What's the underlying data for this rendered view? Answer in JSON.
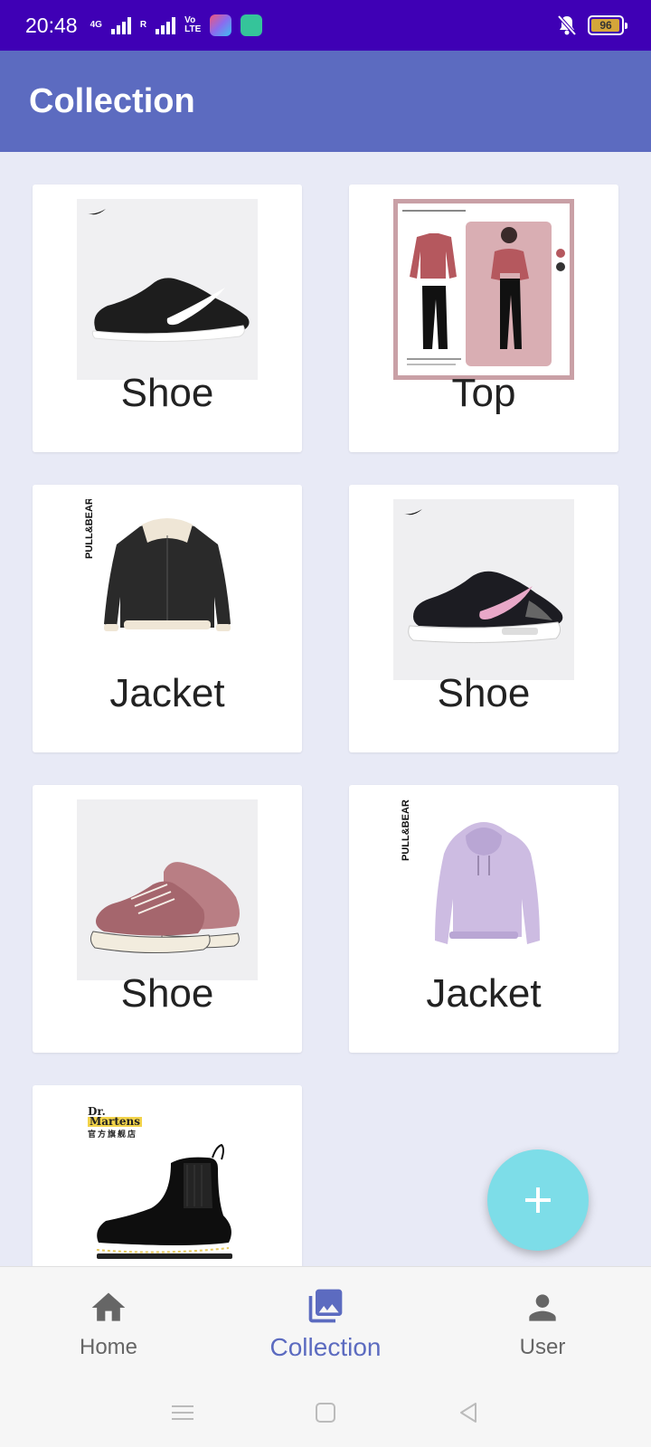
{
  "status_bar": {
    "time": "20:48",
    "network": "4G",
    "roaming": "R",
    "volte_top": "Vo",
    "volte_bottom": "LTE",
    "battery": "96"
  },
  "app_bar": {
    "title": "Collection"
  },
  "items": [
    {
      "label": "Shoe",
      "image": "black-nike-sneaker"
    },
    {
      "label": "Top",
      "image": "pink-top-black-pants-outfit"
    },
    {
      "label": "Jacket",
      "image": "black-shearling-leather-jacket"
    },
    {
      "label": "Shoe",
      "image": "black-pink-nike-air-sneaker"
    },
    {
      "label": "Shoe",
      "image": "pink-converse-high-top"
    },
    {
      "label": "Jacket",
      "image": "lilac-hoodie"
    },
    {
      "label": "",
      "image": "dr-martens-chelsea-boot"
    }
  ],
  "brand_marks": {
    "pull_bear": "PULL&BEAR",
    "dr_martens_top": "Dr.",
    "dr_martens_name": "Martens",
    "dr_martens_store": "官方旗舰店"
  },
  "fab": {
    "icon": "plus-icon"
  },
  "bottom_nav": {
    "items": [
      {
        "label": "Home",
        "icon": "home-icon",
        "active": false
      },
      {
        "label": "Collection",
        "icon": "collection-icon",
        "active": true
      },
      {
        "label": "User",
        "icon": "user-icon",
        "active": false
      }
    ]
  },
  "colors": {
    "status_bar": "#3f00b5",
    "app_bar": "#5c6bc0",
    "background": "#e8eaf6",
    "fab": "#7ddde8",
    "active_nav": "#5c6bc0"
  }
}
